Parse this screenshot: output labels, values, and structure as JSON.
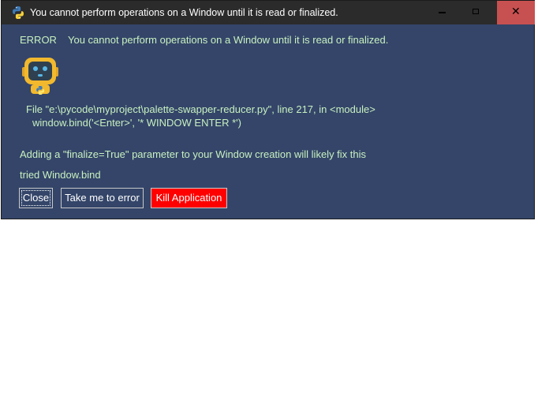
{
  "window": {
    "title": "You cannot perform operations on a Window until it is read or finalized.",
    "app_icon": "python-logo-icon",
    "controls": {
      "minimize_icon": "minimize-icon",
      "maximize_icon": "maximize-icon",
      "close_icon": "close-icon",
      "close_glyph": "✕"
    }
  },
  "error": {
    "label": "ERROR",
    "message": "You cannot perform operations on a Window until it is read or finalized.",
    "mascot_icon": "robot-mascot-icon",
    "traceback": [
      "File \"e:\\pycode\\myproject\\palette-swapper-reducer.py\", line 217, in <module>",
      "window.bind('<Enter>', '* WINDOW ENTER *')"
    ],
    "hint": "Adding a \"finalize=True\" parameter to your Window creation will likely fix this",
    "tried": "tried Window.bind"
  },
  "buttons": {
    "close": "Close",
    "goto_error": "Take me to error",
    "kill": "Kill Application"
  },
  "colors": {
    "background": "#344569",
    "text": "#c8f0c0",
    "titlebar": "#2b2b2b",
    "close_hover": "#c75050",
    "kill_button": "#ff0000"
  }
}
